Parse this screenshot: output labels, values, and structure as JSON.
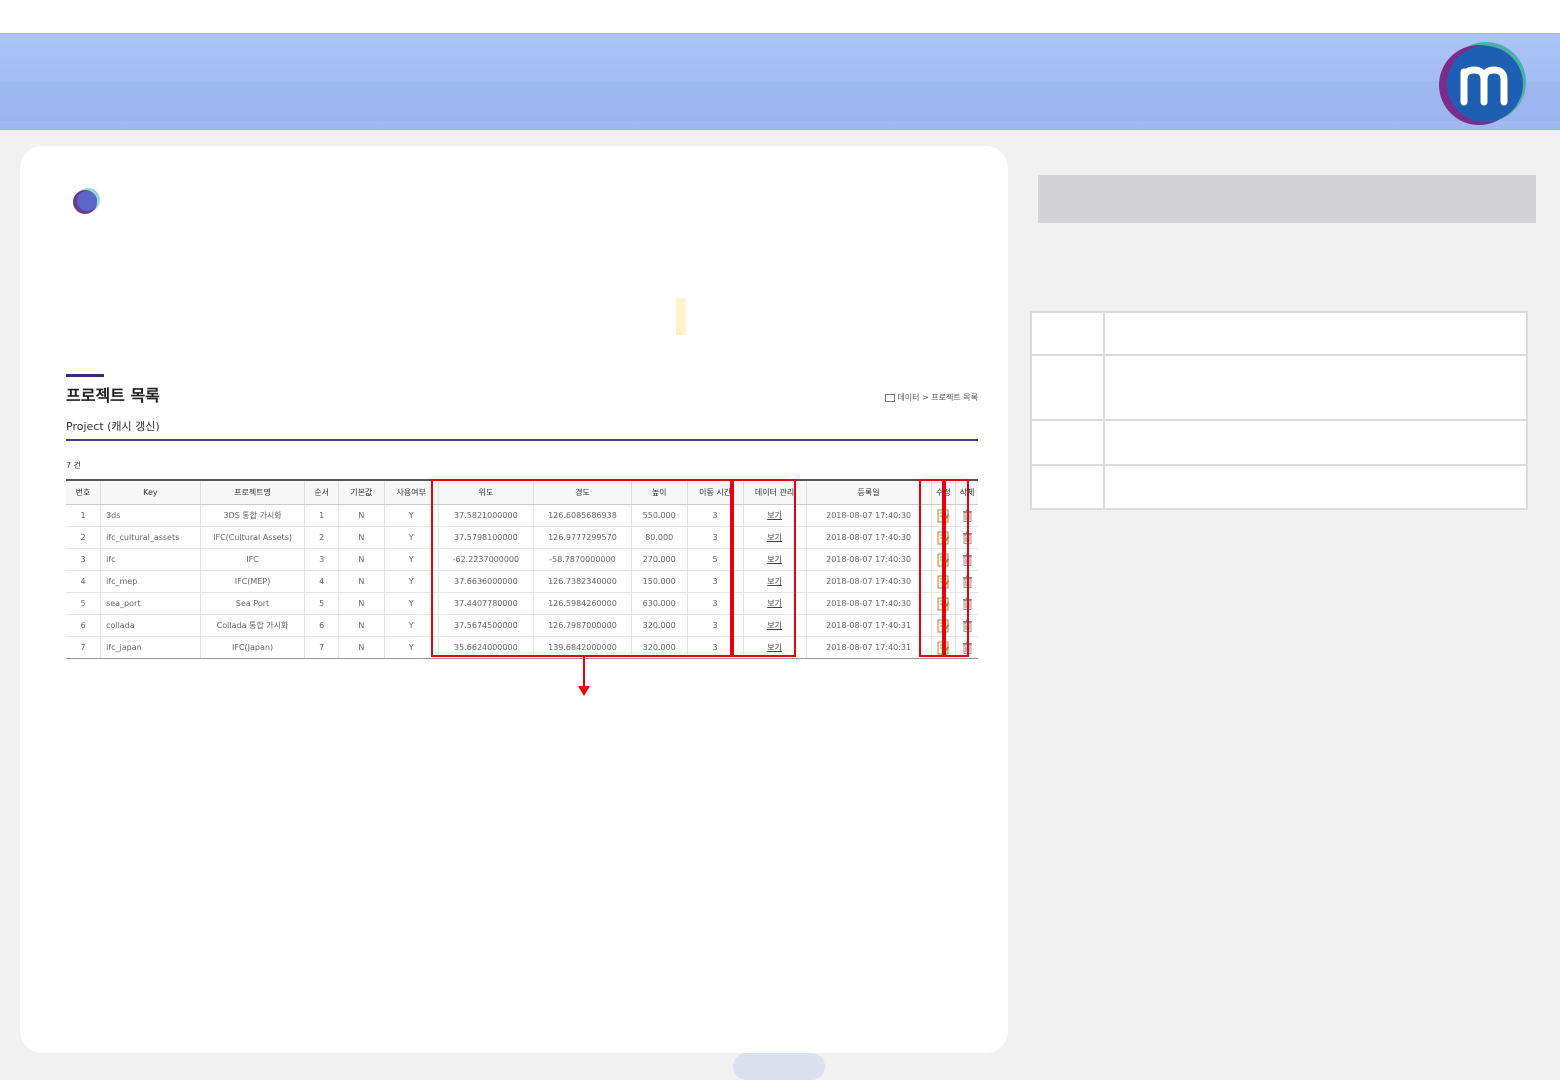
{
  "header": {
    "logo_icon": "m-logo-icon"
  },
  "page": {
    "title": "프로젝트 목록",
    "subtitle": "Project (캐시 갱신)",
    "breadcrumb": {
      "home_icon": "home-icon",
      "items": [
        "데이터",
        "프로젝트 목록"
      ],
      "separator": ">"
    },
    "count": "7 건"
  },
  "table": {
    "columns": [
      "번호",
      "Key",
      "프로젝트명",
      "순서",
      "기본값",
      "사용여부",
      "위도",
      "경도",
      "높이",
      "이동 시간",
      "데이터 관리",
      "등록일",
      "수정",
      "삭제"
    ],
    "rows": [
      {
        "no": "1",
        "key": "3ds",
        "name": "3DS 통합 가시화",
        "order": "1",
        "default": "N",
        "use": "Y",
        "lat": "37.5821000000",
        "lon": "126.6085686938",
        "height": "550.000",
        "duration": "3",
        "data_link": "보기",
        "date": "2018-08-07 17:40:30"
      },
      {
        "no": "2",
        "key": "ifc_cultural_assets",
        "name": "IFC(Cultural Assets)",
        "order": "2",
        "default": "N",
        "use": "Y",
        "lat": "37.5798100000",
        "lon": "126.9777299570",
        "height": "80.000",
        "duration": "3",
        "data_link": "보기",
        "date": "2018-08-07 17:40:30"
      },
      {
        "no": "3",
        "key": "ifc",
        "name": "IFC",
        "order": "3",
        "default": "N",
        "use": "Y",
        "lat": "-62.2237000000",
        "lon": "-58.7870000000",
        "height": "270.000",
        "duration": "5",
        "data_link": "보기",
        "date": "2018-08-07 17:40:30"
      },
      {
        "no": "4",
        "key": "ifc_mep",
        "name": "IFC(MEP)",
        "order": "4",
        "default": "N",
        "use": "Y",
        "lat": "37.6636000000",
        "lon": "126.7382340000",
        "height": "150.000",
        "duration": "3",
        "data_link": "보기",
        "date": "2018-08-07 17:40:30"
      },
      {
        "no": "5",
        "key": "sea_port",
        "name": "Sea Port",
        "order": "5",
        "default": "N",
        "use": "Y",
        "lat": "37.4407780000",
        "lon": "126.5984260000",
        "height": "630.000",
        "duration": "3",
        "data_link": "보기",
        "date": "2018-08-07 17:40:30"
      },
      {
        "no": "6",
        "key": "collada",
        "name": "Collada 통합 가시화",
        "order": "6",
        "default": "N",
        "use": "Y",
        "lat": "37.5674500000",
        "lon": "126.7987000000",
        "height": "320.000",
        "duration": "3",
        "data_link": "보기",
        "date": "2018-08-07 17:40:31"
      },
      {
        "no": "7",
        "key": "ifc_japan",
        "name": "IFC(Japan)",
        "order": "7",
        "default": "N",
        "use": "Y",
        "lat": "35.6624000000",
        "lon": "139.6842000000",
        "height": "320.000",
        "duration": "3",
        "data_link": "보기",
        "date": "2018-08-07 17:40:31"
      }
    ],
    "edit_icon": "edit-icon",
    "delete_icon": "trash-icon"
  },
  "annotation": {
    "highlight_color": "#e8000b",
    "arrow": "arrow-down-icon"
  },
  "colors": {
    "banner": "#a6bff4",
    "accent": "#4a3a86",
    "highlight": "#e8000b"
  }
}
